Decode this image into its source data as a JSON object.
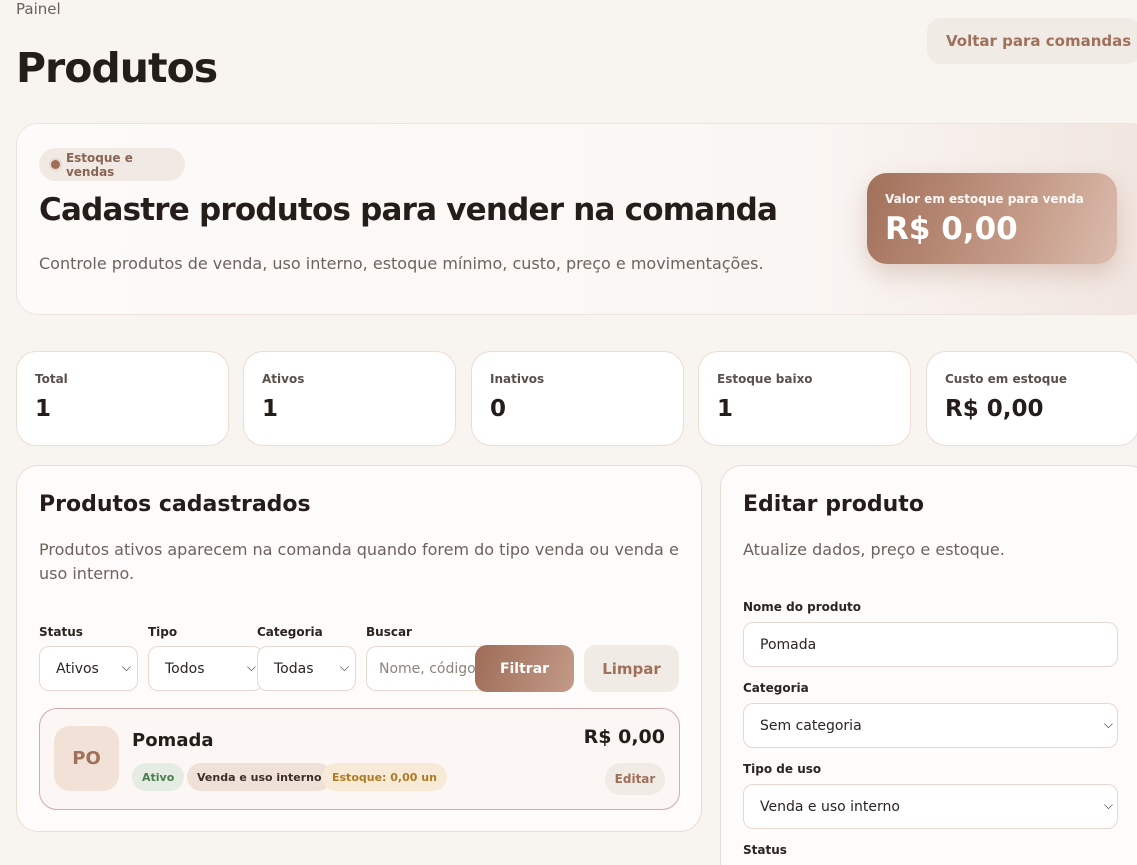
{
  "breadcrumb": "Painel",
  "page_title": "Produtos",
  "back_button": "Voltar para comandas",
  "hero": {
    "pill": "Estoque e vendas",
    "title": "Cadastre produtos para vender na comanda",
    "subtitle": "Controle produtos de venda, uso interno, estoque mínimo, custo, preço e movimentações.",
    "value_label": "Valor em estoque para venda",
    "value_amount": "R$ 0,00"
  },
  "stats": [
    {
      "label": "Total",
      "value": "1"
    },
    {
      "label": "Ativos",
      "value": "1"
    },
    {
      "label": "Inativos",
      "value": "0"
    },
    {
      "label": "Estoque baixo",
      "value": "1"
    },
    {
      "label": "Custo em estoque",
      "value": "R$ 0,00"
    }
  ],
  "list_panel": {
    "title": "Produtos cadastrados",
    "subtitle": "Produtos ativos aparecem na comanda quando forem do tipo venda ou venda e uso interno.",
    "filters": {
      "status": {
        "label": "Status",
        "value": "Ativos"
      },
      "type": {
        "label": "Tipo",
        "value": "Todos"
      },
      "category": {
        "label": "Categoria",
        "value": "Todas"
      },
      "search": {
        "label": "Buscar",
        "placeholder": "Nome, código,"
      },
      "filter_button": "Filtrar",
      "clear_button": "Limpar"
    },
    "products": [
      {
        "initials": "PO",
        "name": "Pomada",
        "status": "Ativo",
        "type": "Venda e uso interno",
        "stock": "Estoque: 0,00 un",
        "price": "R$ 0,00",
        "edit": "Editar"
      }
    ]
  },
  "edit_panel": {
    "title": "Editar produto",
    "subtitle": "Atualize dados, preço e estoque.",
    "name_label": "Nome do produto",
    "name_value": "Pomada",
    "category_label": "Categoria",
    "category_value": "Sem categoria",
    "usage_label": "Tipo de uso",
    "usage_value": "Venda e uso interno",
    "status_label": "Status"
  },
  "icons": {
    "pill_dot": "dot-icon",
    "select_arrow": "chevron-down-icon"
  },
  "colors": {
    "accent": "#a0705a",
    "background": "#f8f4f0",
    "badge_active": "#4b7d4e",
    "badge_stock": "#b07a23"
  }
}
